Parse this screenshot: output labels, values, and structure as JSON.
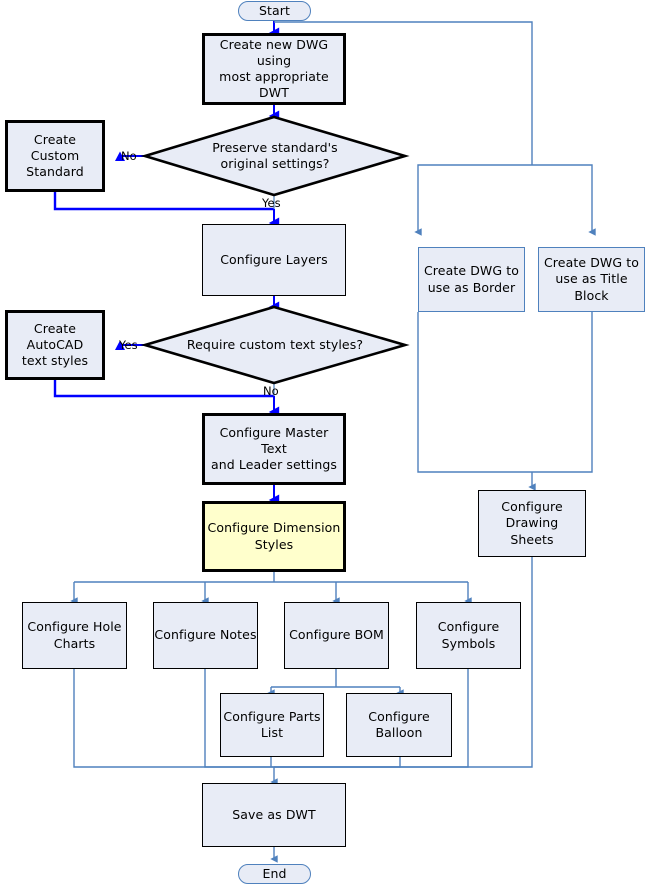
{
  "diagram": {
    "title": "AutoCAD DWT Setup Flowchart",
    "colors": {
      "node_fill": "#e8ecf6",
      "highlight_fill": "#ffffcc",
      "thin_connector": "#4f81bd",
      "bold_connector": "#0000ff",
      "node_border_dark": "#000000"
    },
    "terminals": {
      "start": "Start",
      "end": "End"
    },
    "nodes": {
      "create_new_dwg": "Create new DWG using\nmost appropriate DWT",
      "create_custom_standard": "Create Custom\nStandard",
      "configure_layers": "Configure Layers",
      "create_autocad_text_styles": "Create AutoCAD\ntext styles",
      "configure_master_text": "Configure Master Text\nand Leader settings",
      "configure_dimension_styles": "Configure Dimension\nStyles",
      "configure_hole_charts": "Configure Hole\nCharts",
      "configure_notes": "Configure Notes",
      "configure_bom": "Configure BOM",
      "configure_symbols": "Configure\nSymbols",
      "configure_parts_list": "Configure Parts\nList",
      "configure_balloon": "Configure Balloon",
      "save_as_dwt": "Save as DWT",
      "create_dwg_border": "Create DWG to\nuse as Border",
      "create_dwg_title_block": "Create DWG to\nuse as Title Block",
      "configure_drawing_sheets": "Configure Drawing\nSheets"
    },
    "decisions": {
      "preserve_standard": "Preserve standard's\noriginal settings?",
      "require_text_styles": "Require custom  text styles?"
    },
    "edge_labels": {
      "preserve_no": "No",
      "preserve_yes": "Yes",
      "textstyles_yes": "Yes",
      "textstyles_no": "No"
    }
  }
}
